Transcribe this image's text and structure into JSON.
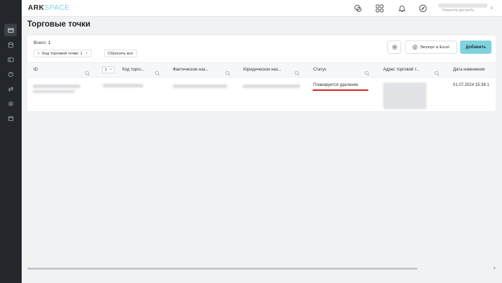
{
  "app": {
    "logo_main": "ARK",
    "logo_accent": "SPACE"
  },
  "topbar": {
    "user_role": "Оператор дистрибу...",
    "icons": [
      "chat-icon",
      "grid-icon",
      "bell-icon",
      "compass-icon"
    ]
  },
  "sidebar": {
    "icons": [
      "store-icon",
      "database-icon",
      "wallet-icon",
      "chart-icon",
      "transfer-icon",
      "settings-icon",
      "calendar-icon"
    ],
    "active_index": 0
  },
  "page": {
    "title": "Торговые точки"
  },
  "filters": {
    "total": "Всего: 1",
    "chip_label": "Код торговой точки: 1",
    "reset_label": "Сбросить все"
  },
  "toolbar": {
    "export_label": "Экспорт в Excel",
    "add_label": "Добавить"
  },
  "table": {
    "columns": [
      "ID",
      "Код торго...",
      "Фактическое наз...",
      "Юридическое наз...",
      "Статус",
      "Адрес торговой т...",
      "Дата изменения"
    ],
    "code_filter_value": "1",
    "rows": [
      {
        "status": "Планируется удаление",
        "date": "01.07.2024 15:38:1"
      }
    ]
  },
  "colors": {
    "accent": "#7fd3df",
    "highlight_underline": "#d62424",
    "sidebar_bg": "#23262b"
  }
}
